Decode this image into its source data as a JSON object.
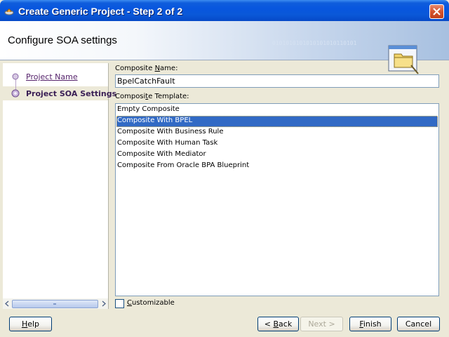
{
  "window": {
    "title": "Create Generic Project - Step 2 of 2"
  },
  "header": {
    "title": "Configure SOA settings",
    "binary_decoration": "0101010101010101010110101",
    "graphic_icon": "folder-window-icon"
  },
  "nav": {
    "items": [
      {
        "label": "Project Name",
        "state": "visited"
      },
      {
        "label": "Project SOA Settings",
        "state": "current"
      }
    ]
  },
  "form": {
    "composite_name": {
      "label_pre": "Composite ",
      "label_key": "N",
      "label_post": "ame:",
      "value": "BpelCatchFault"
    },
    "composite_template": {
      "label_pre": "Composi",
      "label_key": "t",
      "label_post": "e Template:",
      "options": [
        "Empty Composite",
        "Composite With BPEL",
        "Composite With Business Rule",
        "Composite With Human Task",
        "Composite With Mediator",
        "Composite From Oracle BPA Blueprint"
      ],
      "selected_index": 1
    },
    "customizable": {
      "label_key": "C",
      "label_post": "ustomizable",
      "checked": false
    }
  },
  "buttons": {
    "help": {
      "key": "H",
      "rest": "elp"
    },
    "back": {
      "prefix": "< ",
      "key": "B",
      "rest": "ack"
    },
    "next": {
      "label": "Next >"
    },
    "finish": {
      "key": "F",
      "rest": "inish"
    },
    "cancel": {
      "label": "Cancel"
    }
  },
  "colors": {
    "titlebar": "#0856de",
    "selection": "#316ac5",
    "visited_link": "#55226b"
  }
}
